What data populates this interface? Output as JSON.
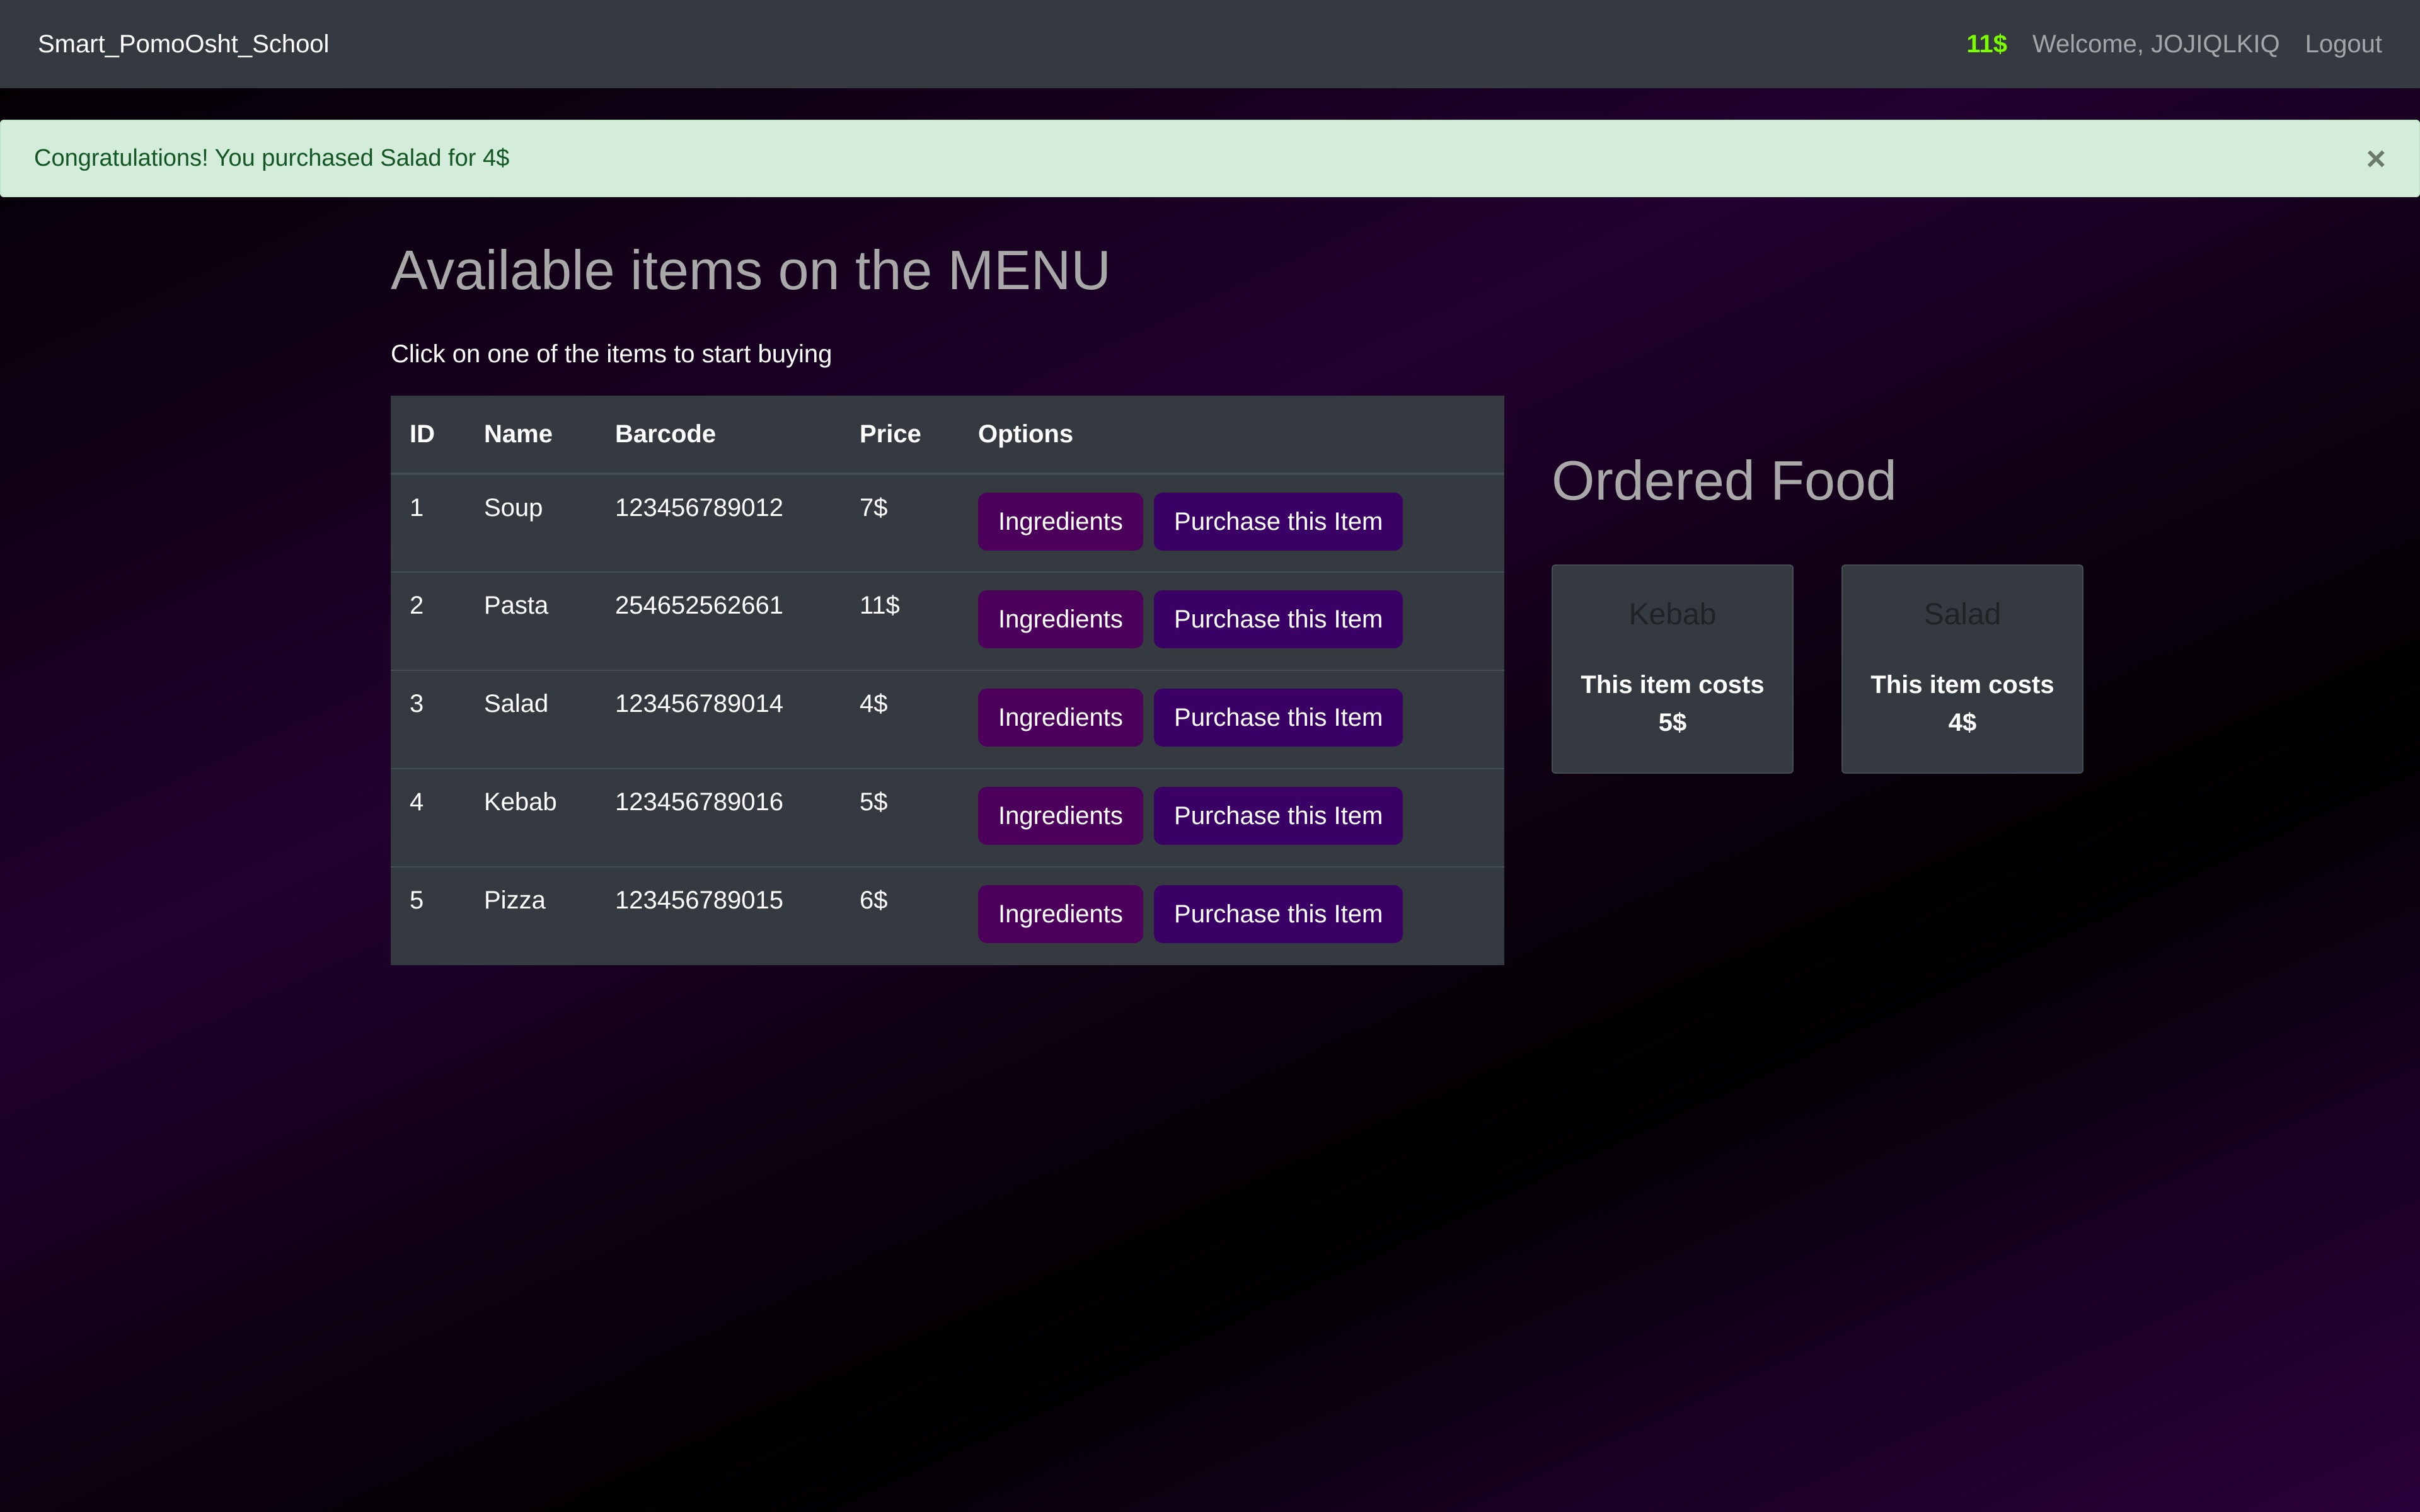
{
  "navbar": {
    "brand": "Smart_PomoOsht_School",
    "balance": "11$",
    "welcome": "Welcome, JOJIQLKIQ",
    "logout": "Logout"
  },
  "alert": {
    "message": "Congratulations! You purchased Salad for 4$",
    "close": "×"
  },
  "main": {
    "title": "Available items on the MENU",
    "subtitle": "Click on one of the items to start buying",
    "table": {
      "headers": [
        "ID",
        "Name",
        "Barcode",
        "Price",
        "Options"
      ],
      "rows": [
        {
          "id": "1",
          "name": "Soup",
          "barcode": "123456789012",
          "price": "7$"
        },
        {
          "id": "2",
          "name": "Pasta",
          "barcode": "254652562661",
          "price": "11$"
        },
        {
          "id": "3",
          "name": "Salad",
          "barcode": "123456789014",
          "price": "4$"
        },
        {
          "id": "4",
          "name": "Kebab",
          "barcode": "123456789016",
          "price": "5$"
        },
        {
          "id": "5",
          "name": "Pizza",
          "barcode": "123456789015",
          "price": "6$"
        }
      ],
      "ingredients_label": "Ingredients",
      "purchase_label": "Purchase this Item"
    }
  },
  "ordered": {
    "title": "Ordered Food",
    "items": [
      {
        "name": "Kebab",
        "price_text": "This item costs 5$"
      },
      {
        "name": "Salad",
        "price_text": "This item costs 4$"
      }
    ]
  },
  "colors": {
    "navbar_bg": "#343a40",
    "balance": "#7cfc00",
    "alert_bg": "#d4edda",
    "alert_text": "#155724",
    "ingredients_button": "#4c005c",
    "purchase_button": "#3a0066"
  }
}
